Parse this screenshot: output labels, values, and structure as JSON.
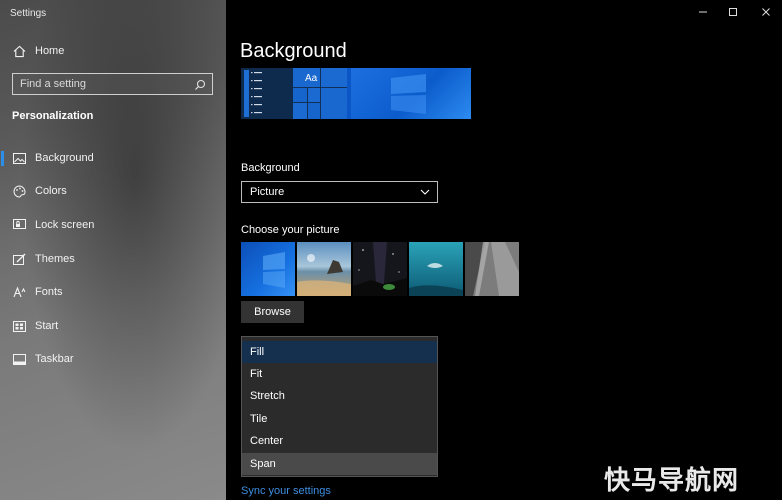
{
  "app": {
    "title": "Settings"
  },
  "sidebar": {
    "home_label": "Home",
    "search_placeholder": "Find a setting",
    "section": "Personalization",
    "items": [
      {
        "label": "Background",
        "icon": "image-icon",
        "active": true
      },
      {
        "label": "Colors",
        "icon": "palette-icon",
        "active": false
      },
      {
        "label": "Lock screen",
        "icon": "lock-screen-icon",
        "active": false
      },
      {
        "label": "Themes",
        "icon": "brush-icon",
        "active": false
      },
      {
        "label": "Fonts",
        "icon": "font-icon",
        "active": false
      },
      {
        "label": "Start",
        "icon": "start-icon",
        "active": false
      },
      {
        "label": "Taskbar",
        "icon": "taskbar-icon",
        "active": false
      }
    ]
  },
  "main": {
    "title": "Background",
    "preview": {
      "tile_label": "Aa"
    },
    "background_label": "Background",
    "background_value": "Picture",
    "choose_label": "Choose your picture",
    "browse_label": "Browse",
    "fit_options": [
      "Fill",
      "Fit",
      "Stretch",
      "Tile",
      "Center",
      "Span"
    ],
    "fit_selected": "Fill",
    "fit_hover": "Span",
    "sync_label": "Sync your settings"
  },
  "watermark": "快马导航网",
  "colors": {
    "accent": "#2b8ee8",
    "link": "#3d8ee0",
    "selected_option": "#15304f",
    "menu_bg": "#2b2b2b"
  }
}
